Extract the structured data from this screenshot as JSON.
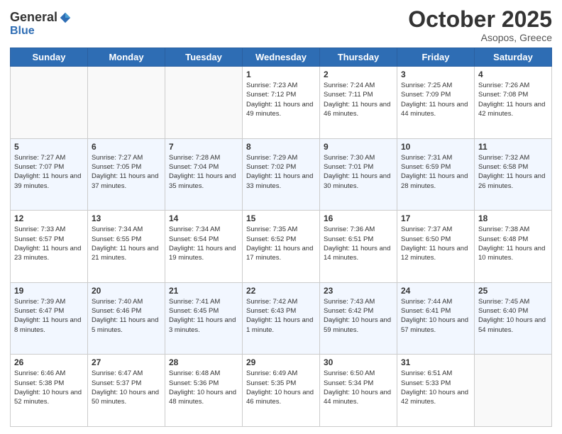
{
  "header": {
    "logo_general": "General",
    "logo_blue": "Blue",
    "month": "October 2025",
    "location": "Asopos, Greece"
  },
  "weekdays": [
    "Sunday",
    "Monday",
    "Tuesday",
    "Wednesday",
    "Thursday",
    "Friday",
    "Saturday"
  ],
  "weeks": [
    [
      {
        "day": "",
        "sunrise": "",
        "sunset": "",
        "daylight": ""
      },
      {
        "day": "",
        "sunrise": "",
        "sunset": "",
        "daylight": ""
      },
      {
        "day": "",
        "sunrise": "",
        "sunset": "",
        "daylight": ""
      },
      {
        "day": "1",
        "sunrise": "Sunrise: 7:23 AM",
        "sunset": "Sunset: 7:12 PM",
        "daylight": "Daylight: 11 hours and 49 minutes."
      },
      {
        "day": "2",
        "sunrise": "Sunrise: 7:24 AM",
        "sunset": "Sunset: 7:11 PM",
        "daylight": "Daylight: 11 hours and 46 minutes."
      },
      {
        "day": "3",
        "sunrise": "Sunrise: 7:25 AM",
        "sunset": "Sunset: 7:09 PM",
        "daylight": "Daylight: 11 hours and 44 minutes."
      },
      {
        "day": "4",
        "sunrise": "Sunrise: 7:26 AM",
        "sunset": "Sunset: 7:08 PM",
        "daylight": "Daylight: 11 hours and 42 minutes."
      }
    ],
    [
      {
        "day": "5",
        "sunrise": "Sunrise: 7:27 AM",
        "sunset": "Sunset: 7:07 PM",
        "daylight": "Daylight: 11 hours and 39 minutes."
      },
      {
        "day": "6",
        "sunrise": "Sunrise: 7:27 AM",
        "sunset": "Sunset: 7:05 PM",
        "daylight": "Daylight: 11 hours and 37 minutes."
      },
      {
        "day": "7",
        "sunrise": "Sunrise: 7:28 AM",
        "sunset": "Sunset: 7:04 PM",
        "daylight": "Daylight: 11 hours and 35 minutes."
      },
      {
        "day": "8",
        "sunrise": "Sunrise: 7:29 AM",
        "sunset": "Sunset: 7:02 PM",
        "daylight": "Daylight: 11 hours and 33 minutes."
      },
      {
        "day": "9",
        "sunrise": "Sunrise: 7:30 AM",
        "sunset": "Sunset: 7:01 PM",
        "daylight": "Daylight: 11 hours and 30 minutes."
      },
      {
        "day": "10",
        "sunrise": "Sunrise: 7:31 AM",
        "sunset": "Sunset: 6:59 PM",
        "daylight": "Daylight: 11 hours and 28 minutes."
      },
      {
        "day": "11",
        "sunrise": "Sunrise: 7:32 AM",
        "sunset": "Sunset: 6:58 PM",
        "daylight": "Daylight: 11 hours and 26 minutes."
      }
    ],
    [
      {
        "day": "12",
        "sunrise": "Sunrise: 7:33 AM",
        "sunset": "Sunset: 6:57 PM",
        "daylight": "Daylight: 11 hours and 23 minutes."
      },
      {
        "day": "13",
        "sunrise": "Sunrise: 7:34 AM",
        "sunset": "Sunset: 6:55 PM",
        "daylight": "Daylight: 11 hours and 21 minutes."
      },
      {
        "day": "14",
        "sunrise": "Sunrise: 7:34 AM",
        "sunset": "Sunset: 6:54 PM",
        "daylight": "Daylight: 11 hours and 19 minutes."
      },
      {
        "day": "15",
        "sunrise": "Sunrise: 7:35 AM",
        "sunset": "Sunset: 6:52 PM",
        "daylight": "Daylight: 11 hours and 17 minutes."
      },
      {
        "day": "16",
        "sunrise": "Sunrise: 7:36 AM",
        "sunset": "Sunset: 6:51 PM",
        "daylight": "Daylight: 11 hours and 14 minutes."
      },
      {
        "day": "17",
        "sunrise": "Sunrise: 7:37 AM",
        "sunset": "Sunset: 6:50 PM",
        "daylight": "Daylight: 11 hours and 12 minutes."
      },
      {
        "day": "18",
        "sunrise": "Sunrise: 7:38 AM",
        "sunset": "Sunset: 6:48 PM",
        "daylight": "Daylight: 11 hours and 10 minutes."
      }
    ],
    [
      {
        "day": "19",
        "sunrise": "Sunrise: 7:39 AM",
        "sunset": "Sunset: 6:47 PM",
        "daylight": "Daylight: 11 hours and 8 minutes."
      },
      {
        "day": "20",
        "sunrise": "Sunrise: 7:40 AM",
        "sunset": "Sunset: 6:46 PM",
        "daylight": "Daylight: 11 hours and 5 minutes."
      },
      {
        "day": "21",
        "sunrise": "Sunrise: 7:41 AM",
        "sunset": "Sunset: 6:45 PM",
        "daylight": "Daylight: 11 hours and 3 minutes."
      },
      {
        "day": "22",
        "sunrise": "Sunrise: 7:42 AM",
        "sunset": "Sunset: 6:43 PM",
        "daylight": "Daylight: 11 hours and 1 minute."
      },
      {
        "day": "23",
        "sunrise": "Sunrise: 7:43 AM",
        "sunset": "Sunset: 6:42 PM",
        "daylight": "Daylight: 10 hours and 59 minutes."
      },
      {
        "day": "24",
        "sunrise": "Sunrise: 7:44 AM",
        "sunset": "Sunset: 6:41 PM",
        "daylight": "Daylight: 10 hours and 57 minutes."
      },
      {
        "day": "25",
        "sunrise": "Sunrise: 7:45 AM",
        "sunset": "Sunset: 6:40 PM",
        "daylight": "Daylight: 10 hours and 54 minutes."
      }
    ],
    [
      {
        "day": "26",
        "sunrise": "Sunrise: 6:46 AM",
        "sunset": "Sunset: 5:38 PM",
        "daylight": "Daylight: 10 hours and 52 minutes."
      },
      {
        "day": "27",
        "sunrise": "Sunrise: 6:47 AM",
        "sunset": "Sunset: 5:37 PM",
        "daylight": "Daylight: 10 hours and 50 minutes."
      },
      {
        "day": "28",
        "sunrise": "Sunrise: 6:48 AM",
        "sunset": "Sunset: 5:36 PM",
        "daylight": "Daylight: 10 hours and 48 minutes."
      },
      {
        "day": "29",
        "sunrise": "Sunrise: 6:49 AM",
        "sunset": "Sunset: 5:35 PM",
        "daylight": "Daylight: 10 hours and 46 minutes."
      },
      {
        "day": "30",
        "sunrise": "Sunrise: 6:50 AM",
        "sunset": "Sunset: 5:34 PM",
        "daylight": "Daylight: 10 hours and 44 minutes."
      },
      {
        "day": "31",
        "sunrise": "Sunrise: 6:51 AM",
        "sunset": "Sunset: 5:33 PM",
        "daylight": "Daylight: 10 hours and 42 minutes."
      },
      {
        "day": "",
        "sunrise": "",
        "sunset": "",
        "daylight": ""
      }
    ]
  ]
}
